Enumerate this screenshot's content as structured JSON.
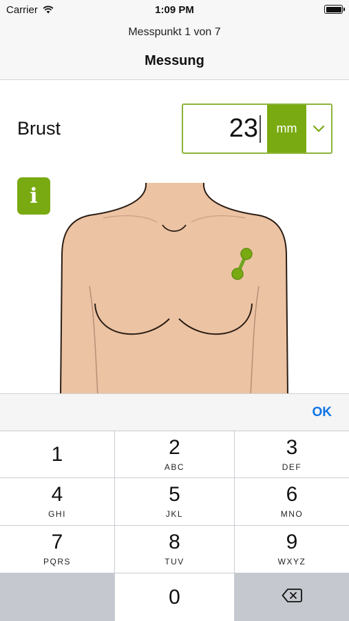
{
  "status_bar": {
    "carrier": "Carrier",
    "time": "1:09 PM",
    "wifi_icon": "wifi-icon",
    "battery_icon": "battery-icon"
  },
  "nav": {
    "subtitle": "Messpunkt 1 von 7",
    "title": "Messung"
  },
  "measurement": {
    "label": "Brust",
    "value": "23",
    "unit": "mm",
    "dropdown_icon": "chevron-down-icon"
  },
  "info_button": {
    "icon": "info-icon",
    "glyph": "i"
  },
  "illustration": {
    "subject": "female-torso",
    "marker": "caliper-marker"
  },
  "keyboard": {
    "done_label": "OK",
    "keys": [
      {
        "num": "1",
        "letters": ""
      },
      {
        "num": "2",
        "letters": "ABC"
      },
      {
        "num": "3",
        "letters": "DEF"
      },
      {
        "num": "4",
        "letters": "GHI"
      },
      {
        "num": "5",
        "letters": "JKL"
      },
      {
        "num": "6",
        "letters": "MNO"
      },
      {
        "num": "7",
        "letters": "PQRS"
      },
      {
        "num": "8",
        "letters": "TUV"
      },
      {
        "num": "9",
        "letters": "WXYZ"
      },
      {
        "num": "0",
        "letters": ""
      }
    ],
    "delete_icon": "backspace-icon"
  },
  "colors": {
    "accent_green": "#7aaa12",
    "border_green": "#8cb33a",
    "link_blue": "#0f74e8",
    "skin": "#ecc3a3"
  }
}
